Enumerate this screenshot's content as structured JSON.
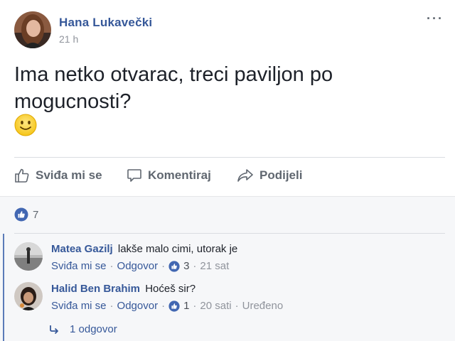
{
  "post": {
    "author": "Hana Lukavečki",
    "timestamp": "21 h",
    "more_icon": "more-dots-icon",
    "text": "Ima netko otvarac, treci paviljon po mogucnosti?",
    "emoji": "slightly-smiling-face"
  },
  "actions": {
    "like_label": "Sviđa mi se",
    "comment_label": "Komentiraj",
    "share_label": "Podijeli"
  },
  "reactions": {
    "count": "7"
  },
  "comments": [
    {
      "name": "Matea Gazilj",
      "text": "lakše malo cimi, utorak je",
      "like_label": "Sviđa mi se",
      "reply_label": "Odgovor",
      "likes": "3",
      "time": "21 sat",
      "edited": ""
    },
    {
      "name": "Halid Ben Brahim",
      "text": "Hoćeš sir?",
      "like_label": "Sviđa mi se",
      "reply_label": "Odgovor",
      "likes": "1",
      "time": "20 sati",
      "edited": "Uređeno"
    }
  ],
  "replies": {
    "label": "1 odgovor"
  },
  "colors": {
    "link_blue": "#365899",
    "like_blue": "#4267b2",
    "muted": "#90949c",
    "background": "#f6f7f9"
  }
}
